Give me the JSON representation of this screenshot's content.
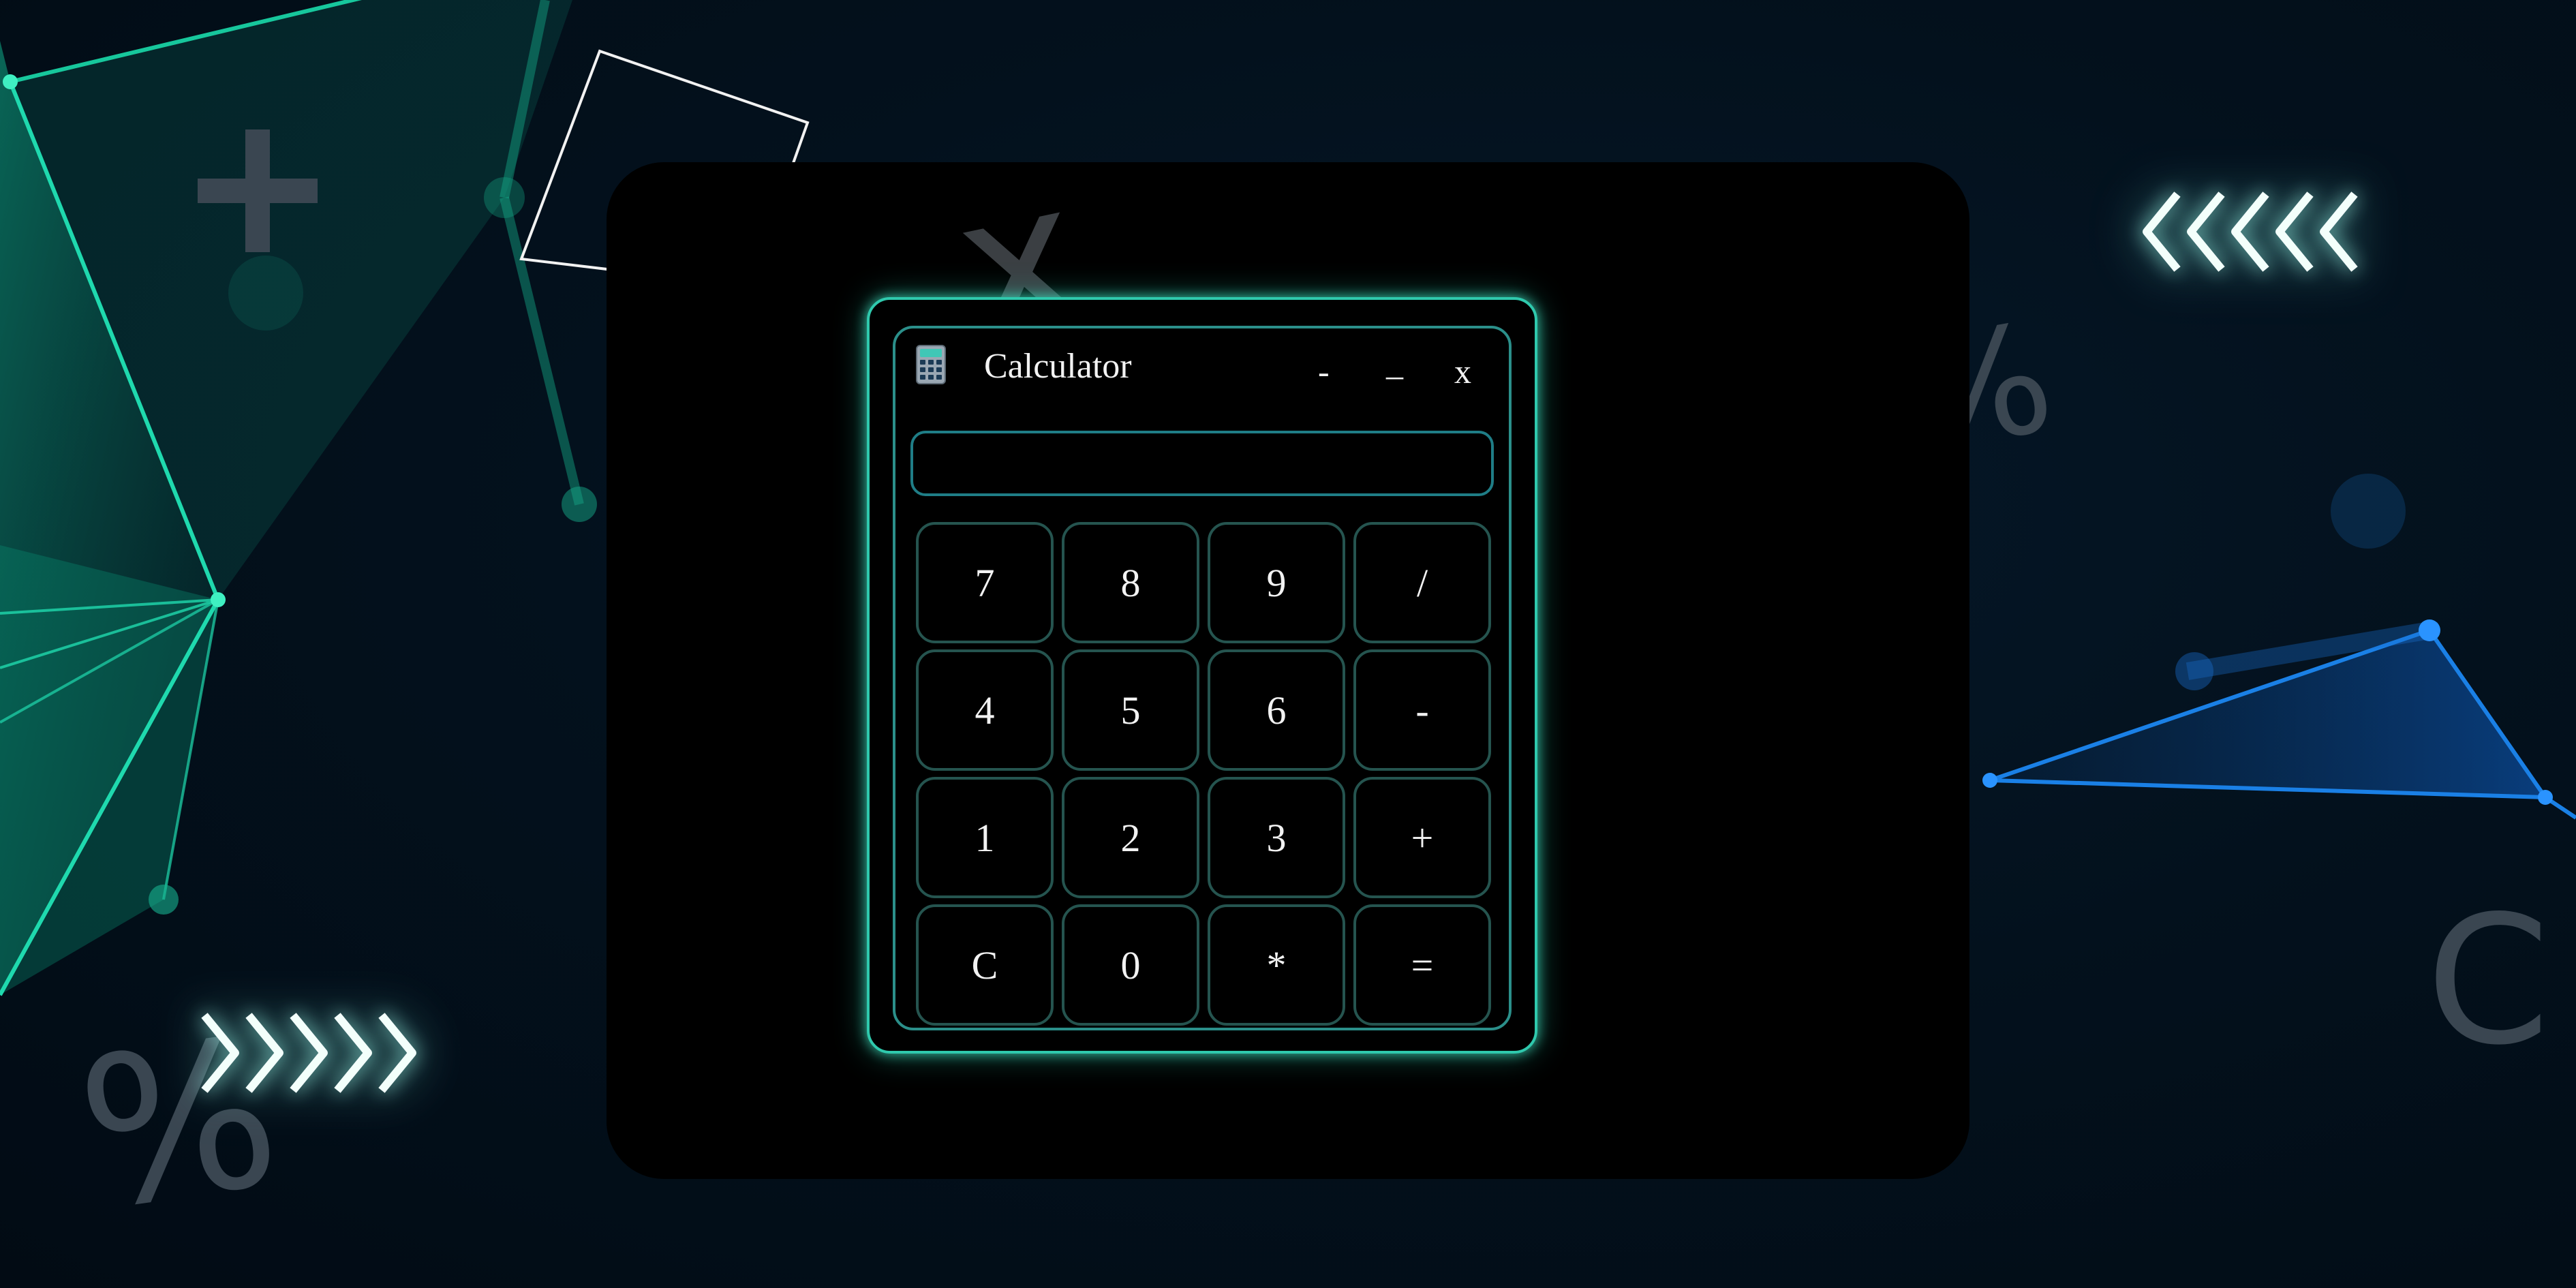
{
  "window": {
    "title": "Calculator",
    "icon": "calculator-icon",
    "controls": {
      "minimize": "-",
      "maximize": "_",
      "close": "x"
    }
  },
  "display": {
    "value": "",
    "placeholder": ""
  },
  "keypad": {
    "keys": [
      "7",
      "8",
      "9",
      "/",
      "4",
      "5",
      "6",
      "-",
      "1",
      "2",
      "3",
      "+",
      "C",
      "0",
      "*",
      "="
    ]
  },
  "decorations": {
    "glyph_times": "x",
    "glyph_percent_1": "%",
    "glyph_percent_2": "%",
    "glyph_c": "C"
  },
  "colors": {
    "accent": "#2fc9ad",
    "background": "#03111d",
    "panel": "#000000",
    "text": "#f2f2f2",
    "network_green": "#19d6a4",
    "network_blue": "#1a7fe0"
  }
}
